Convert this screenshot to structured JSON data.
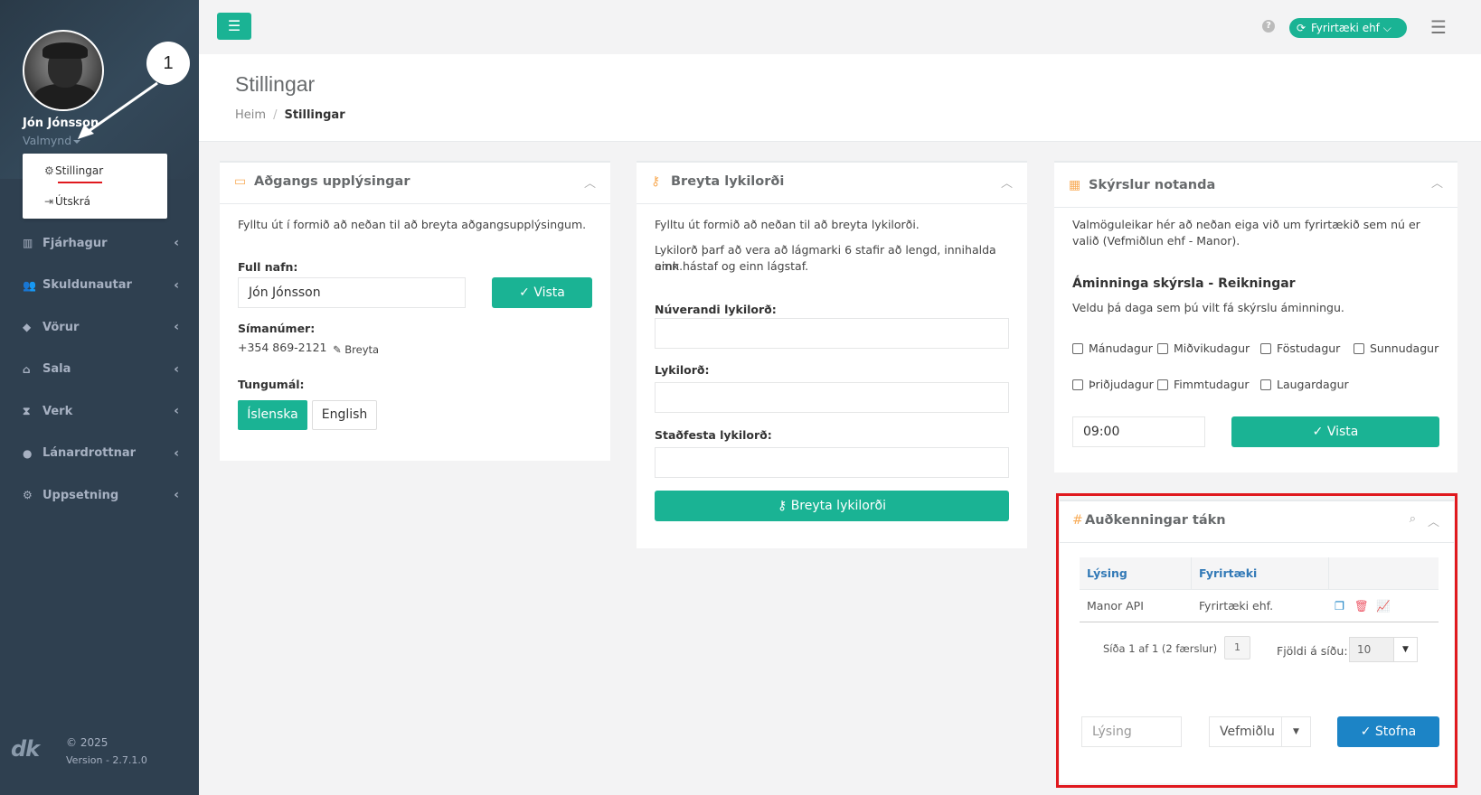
{
  "user": {
    "name": "Jón Jónsson",
    "role": "Valmynd"
  },
  "callout": {
    "number": "1"
  },
  "user_menu": {
    "settings": "Stillingar",
    "logout": "Útskrá"
  },
  "nav": [
    {
      "label": "Fjárhagur",
      "icon": "bank-icon"
    },
    {
      "label": "Skuldunautar",
      "icon": "users-icon"
    },
    {
      "label": "Vörur",
      "icon": "tag-icon"
    },
    {
      "label": "Sala",
      "icon": "basket-icon"
    },
    {
      "label": "Verk",
      "icon": "hourglass-icon"
    },
    {
      "label": "Lánardrottnar",
      "icon": "user-circle-icon"
    },
    {
      "label": "Uppsetning",
      "icon": "cogs-icon"
    }
  ],
  "footer": {
    "logo": "dk",
    "copyright": "© 2025",
    "version": "Version - 2.7.1.0"
  },
  "topbar": {
    "company": "Fyrirtæki ehf",
    "help": "?"
  },
  "page": {
    "title": "Stillingar",
    "breadcrumb_home": "Heim",
    "breadcrumb_current": "Stillingar"
  },
  "access_panel": {
    "title": "Aðgangs upplýsingar",
    "intro": "Fylltu út í formið að neðan til að breyta aðgangsupplýsingum.",
    "name_label": "Full nafn:",
    "name_value": "Jón Jónsson",
    "save": "Vista",
    "phone_label": "Símanúmer:",
    "phone_value": "+354 869-2121",
    "phone_edit": "Breyta",
    "language_label": "Tungumál:",
    "lang_is": "Íslenska",
    "lang_en": "English"
  },
  "password_panel": {
    "title": "Breyta lykilorði",
    "intro": "Fylltu út formið að neðan til að breyta lykilorði.",
    "rules_line1": "Lykilorð þarf að vera að lágmarki 6 stafir að lengd, innihalda amk.",
    "rules_line2": "einn hástaf og einn lágstaf.",
    "current_label": "Núverandi lykilorð:",
    "new_label": "Lykilorð:",
    "confirm_label": "Staðfesta lykilorð:",
    "submit": "Breyta lykilorði"
  },
  "reports_panel": {
    "title": "Skýrslur notanda",
    "intro_line1": "Valmöguleikar hér að neðan eiga við um fyrirtækið sem nú er",
    "intro_line2": "valið (Vefmiðlun ehf - Manor).",
    "subtitle": "Áminninga skýrsla - Reikningar",
    "hint": "Veldu þá daga sem þú vilt fá skýrslu áminningu.",
    "days_row1": [
      "Mánudagur",
      "Miðvikudagur",
      "Föstudagur",
      "Sunnudagur"
    ],
    "days_row2": [
      "Þriðjudagur",
      "Fimmtudagur",
      "Laugardagur"
    ],
    "time_value": "09:00",
    "save": "Vista"
  },
  "tokens_panel": {
    "title": "Auðkenningar tákn",
    "columns": [
      "Lýsing",
      "Fyrirtæki"
    ],
    "rows": [
      {
        "description": "Manor API",
        "company": "Fyrirtæki ehf."
      }
    ],
    "pager_text": "Síða 1 af 1 (2 færslur)",
    "page_number": "1",
    "page_size_label": "Fjöldi á síðu:",
    "page_size": "10",
    "new_desc_placeholder": "Lýsing",
    "new_company": "Vefmiðlu",
    "create": "Stofna"
  },
  "colors": {
    "sidebar": "#2f4050",
    "accent": "#1ab394",
    "primary": "#1c84c6",
    "highlight": "#e0191e"
  }
}
